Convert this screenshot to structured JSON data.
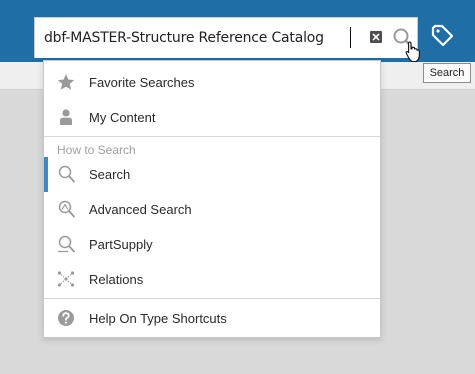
{
  "search": {
    "value": "dbf-MASTER-Structure Reference Catalog",
    "search_tooltip": "Search"
  },
  "dropdown": {
    "items": [
      {
        "label": "Favorite Searches",
        "icon": "star-icon"
      },
      {
        "label": "My Content",
        "icon": "person-icon"
      }
    ],
    "section_label": "How to Search",
    "search_items": [
      {
        "label": "Search",
        "icon": "magnifier-icon",
        "active": true
      },
      {
        "label": "Advanced Search",
        "icon": "advanced-search-icon"
      },
      {
        "label": "PartSupply",
        "icon": "partsupply-icon"
      },
      {
        "label": "Relations",
        "icon": "relations-icon"
      }
    ],
    "help_item": {
      "label": "Help On Type Shortcuts",
      "icon": "help-icon"
    }
  },
  "colors": {
    "topbar": "#1f6ea5",
    "active_accent": "#3b87c8",
    "icon_gray": "#9a9a9a"
  }
}
